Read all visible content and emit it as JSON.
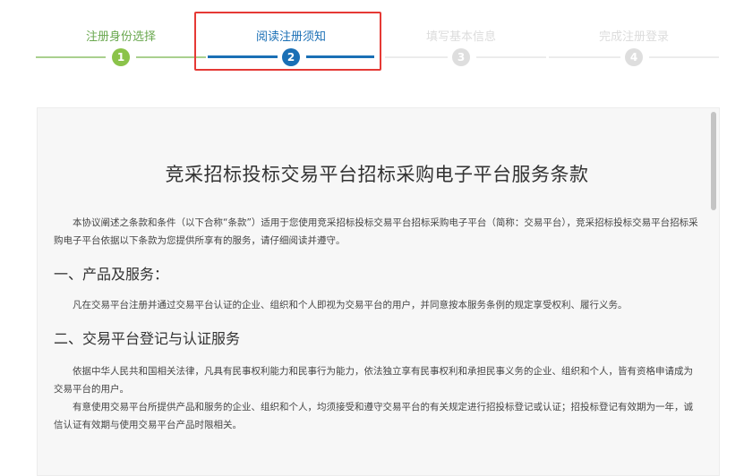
{
  "steps": [
    {
      "label": "注册身份选择",
      "number": "1",
      "state": "done"
    },
    {
      "label": "阅读注册须知",
      "number": "2",
      "state": "active"
    },
    {
      "label": "填写基本信息",
      "number": "3",
      "state": "todo"
    },
    {
      "label": "完成注册登录",
      "number": "4",
      "state": "todo"
    }
  ],
  "terms": {
    "title": "竞采招标投标交易平台招标采购电子平台服务条款",
    "intro": "本协议阐述之条款和条件（以下合称“条款”）适用于您使用竞采招标投标交易平台招标采购电子平台（简称：交易平台），竞采招标投标交易平台招标采购电子平台依据以下条款为您提供所享有的服务，请仔细阅读并遵守。",
    "section1_title": "一、产品及服务：",
    "section1_text": "凡在交易平台注册并通过交易平台认证的企业、组织和个人即视为交易平台的用户，并同意按本服务条例的规定享受权利、履行义务。",
    "section2_title": "二、交易平台登记与认证服务",
    "section2_text1": "依据中华人民共和国相关法律，凡具有民事权利能力和民事行为能力，依法独立享有民事权利和承担民事义务的企业、组织和个人，皆有资格申请成为交易平台的用户。",
    "section2_text2": "有意使用交易平台所提供产品和服务的企业、组织和个人，均须接受和遵守交易平台的有关规定进行招投标登记或认证；招投标登记有效期为一年，诚信认证有效期与使用交易平台产品时限相关。"
  },
  "colors": {
    "done": "#8bc34a",
    "active": "#1a6fb5",
    "todo": "#dedede",
    "highlight": "#e53935"
  }
}
